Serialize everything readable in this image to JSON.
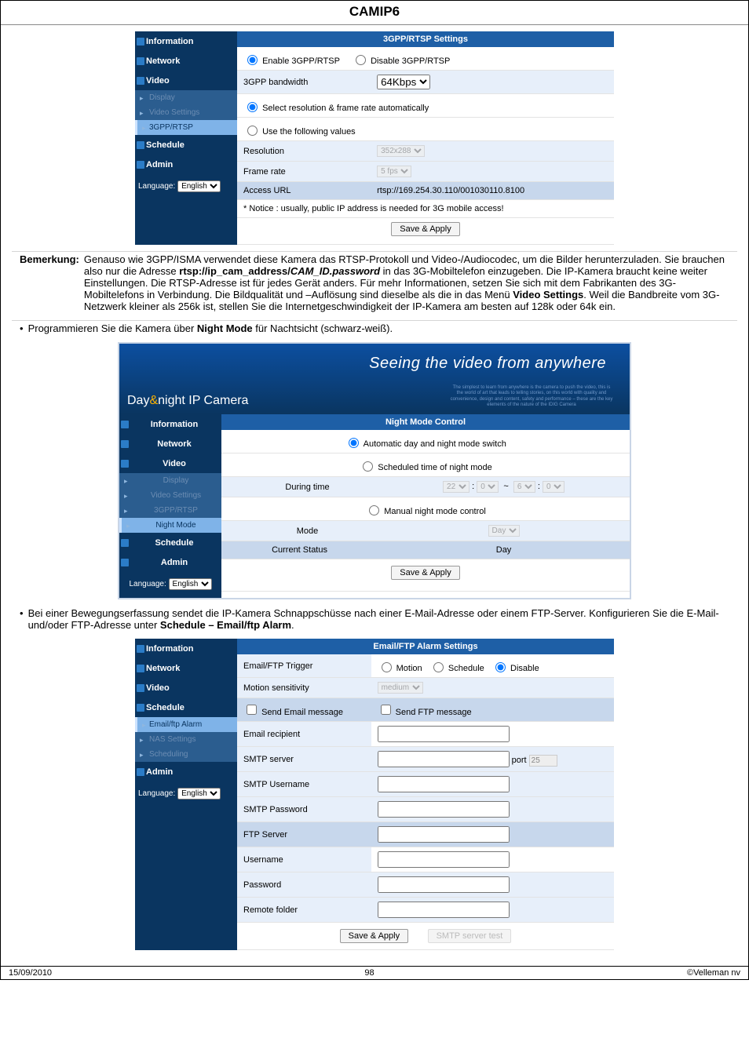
{
  "page_title": "CAMIP6",
  "screenshot1": {
    "nav": {
      "information": "Information",
      "network": "Network",
      "video": "Video",
      "display": "Display",
      "video_settings": "Video Settings",
      "tgpp": "3GPP/RTSP",
      "schedule": "Schedule",
      "admin": "Admin",
      "lang_label": "Language:",
      "lang_value": "English"
    },
    "header": "3GPP/RTSP Settings",
    "enable_label": "Enable 3GPP/RTSP",
    "disable_label": "Disable 3GPP/RTSP",
    "bw_label": "3GPP bandwidth",
    "bw_value": "64Kbps",
    "auto_label": "Select resolution & frame rate automatically",
    "use_label": "Use the following values",
    "res_label": "Resolution",
    "res_value": "352x288",
    "fr_label": "Frame rate",
    "fr_value": "5 fps",
    "url_label": "Access URL",
    "url_value": "rtsp://169.254.30.110/001030110.8100",
    "notice": "* Notice : usually, public IP address is needed for 3G mobile access!",
    "save": "Save & Apply"
  },
  "remark": {
    "label": "Bemerkung:",
    "body_1": "Genauso wie 3GPP/ISMA verwendet diese Kamera das RTSP-Protokoll und Video-/Audiocodec, um die Bilder herunterzuladen. Sie brauchen also nur die Adresse ",
    "rtsp_bold": "rtsp://ip_cam_address/",
    "rtsp_italic": "CAM_ID.password",
    "body_2": " in das 3G-Mobiltelefon einzugeben. Die IP-Kamera braucht keine weiter Einstellungen. Die RTSP-Adresse ist für jedes Gerät anders. Für mehr Informationen, setzen Sie sich mit dem Fabrikanten des 3G-Mobiltelefons in Verbindung. Die Bildqualität und –Auflösung sind dieselbe als die in das Menü ",
    "menu_bold": "Video Settings",
    "body_3": ". Weil die Bandbreite vom 3G-Netzwerk kleiner als 256k ist, stellen Sie die Internetgeschwindigkeit der IP-Kamera am besten auf 128k oder 64k ein."
  },
  "bullet1_a": "Programmieren Sie die Kamera über ",
  "bullet1_bold": "Night Mode",
  "bullet1_b": " für Nachtsicht (schwarz-weiß).",
  "screenshot2": {
    "hero_title": "Seeing the video from anywhere",
    "hero_logo_a": "Day",
    "hero_logo_amp": "&",
    "hero_logo_b": "night IP Camera",
    "hero_fine": "The simplest to learn from anywhere is the camera to push the video, this is the world of art that leads to telling stories, on this world with quality and convenience, design and content, safety and performance – these are the key elements of the nature of the IDIG Camera",
    "nav": {
      "information": "Information",
      "network": "Network",
      "video": "Video",
      "display": "Display",
      "video_settings": "Video Settings",
      "tgpp": "3GPP/RTSP",
      "night_mode": "Night Mode",
      "schedule": "Schedule",
      "admin": "Admin",
      "lang_label": "Language:",
      "lang_value": "English"
    },
    "header": "Night Mode Control",
    "auto": "Automatic day and night mode switch",
    "sched": "Scheduled time of night mode",
    "during": "During time",
    "dh1": "22",
    "dm1": "0",
    "sep": "~",
    "dh2": "6",
    "dm2": "0",
    "manual": "Manual night mode control",
    "mode_label": "Mode",
    "mode_value": "Day",
    "status_label": "Current Status",
    "status_value": "Day",
    "save": "Save & Apply"
  },
  "bullet2_a": "Bei einer Bewegungserfassung sendet die IP-Kamera Schnappschüsse nach einer E-Mail-Adresse oder einem FTP-Server. Konfigurieren Sie die E-Mail- und/oder FTP-Adresse unter ",
  "bullet2_bold": "Schedule – Email/ftp Alarm",
  "bullet2_b": ".",
  "screenshot3": {
    "nav": {
      "information": "Information",
      "network": "Network",
      "video": "Video",
      "schedule": "Schedule",
      "email_ftp": "Email/ftp Alarm",
      "nas": "NAS Settings",
      "scheduling": "Scheduling",
      "admin": "Admin",
      "lang_label": "Language:",
      "lang_value": "English"
    },
    "header": "Email/FTP Alarm Settings",
    "trigger_label": "Email/FTP Trigger",
    "motion": "Motion",
    "schedule_opt": "Schedule",
    "disable_opt": "Disable",
    "sensitivity_label": "Motion sensitivity",
    "sensitivity_value": "medium",
    "send_email": "Send Email message",
    "send_ftp": "Send FTP message",
    "recipient": "Email recipient",
    "smtp_server": "SMTP server",
    "port_label": "port",
    "port_value": "25",
    "smtp_user": "SMTP Username",
    "smtp_pass": "SMTP Password",
    "ftp_server": "FTP Server",
    "username": "Username",
    "password": "Password",
    "remote_folder": "Remote folder",
    "save": "Save & Apply",
    "smtp_test": "SMTP server test"
  },
  "footer": {
    "date": "15/09/2010",
    "pagenum": "98",
    "copyright": "©Velleman nv"
  }
}
